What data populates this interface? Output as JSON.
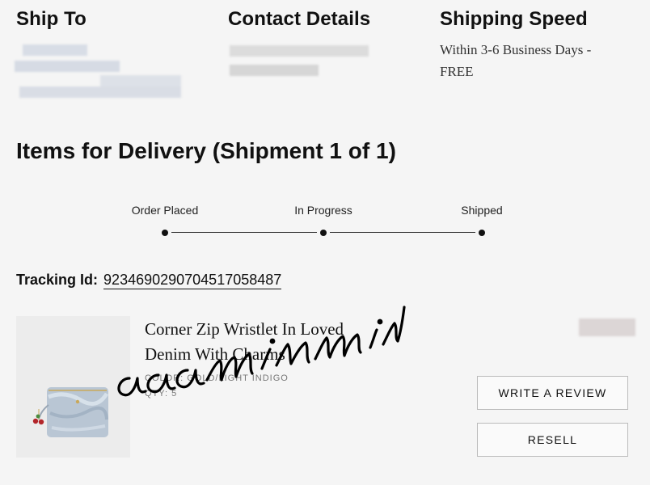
{
  "ship_to": {
    "title": "Ship To"
  },
  "contact": {
    "title": "Contact Details"
  },
  "shipping_speed": {
    "title": "Shipping Speed",
    "value": "Within 3-6 Business Days - FREE"
  },
  "section_title": "Items for Delivery (Shipment 1 of 1)",
  "progress": {
    "steps": [
      "Order Placed",
      "In Progress",
      "Shipped"
    ]
  },
  "tracking": {
    "label": "Tracking Id:",
    "id": "9234690290704517058487"
  },
  "item": {
    "name": "Corner Zip Wristlet In Loved Denim With Charms",
    "color": "COLOR: GOLD/LIGHT INDIGO",
    "qty": "QTY: 5"
  },
  "actions": {
    "review": "WRITE A REVIEW",
    "resell": "RESELL"
  },
  "watermark": "aaaminmin"
}
